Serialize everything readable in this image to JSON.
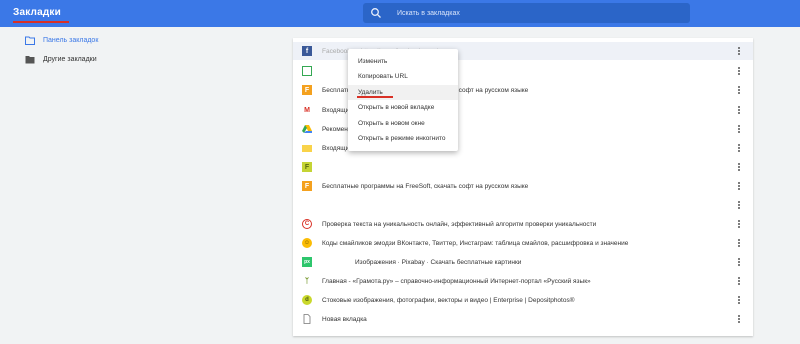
{
  "header": {
    "title": "Закладки",
    "search_placeholder": "Искать в закладках"
  },
  "sidebar": {
    "items": [
      {
        "label": "Панель закладок",
        "active": true
      },
      {
        "label": "Другие закладки",
        "active": false
      }
    ]
  },
  "bookmarks": [
    {
      "icon": "facebook-icon",
      "text": "Facebook — https://www.facebook.com/...",
      "faded": true
    },
    {
      "icon": "green-page-icon",
      "text": ""
    },
    {
      "icon": "freesoft-icon",
      "text": "Бесплатные программы на FreeSoft, скачать софт на русском языке"
    },
    {
      "icon": "gmail-icon",
      "text": "Входящие"
    },
    {
      "icon": "google-drive-icon",
      "text": "Рекомендации"
    },
    {
      "icon": "mail-icon",
      "text": "Входящие"
    },
    {
      "icon": "yellow-page-icon",
      "text": ""
    },
    {
      "icon": "freesoft-icon",
      "text": "Бесплатные программы на FreeSoft, скачать софт на русском языке"
    },
    {
      "icon": "blank-icon",
      "text": ""
    },
    {
      "icon": "copyright-icon",
      "text": "Проверка текста на уникальность онлайн, эффективный алгоритм проверки уникальности"
    },
    {
      "icon": "smiley-icon",
      "text": "Коды смайликов эмодзи ВКонтакте, Твиттер, Инстаграм: таблица смайлов, расшифровка и значение"
    },
    {
      "icon": "pixabay-icon",
      "text": "Изображения · Pixabay · Скачать бесплатные картинки"
    },
    {
      "icon": "gramota-icon",
      "text": "Главная - «Грамота.ру» – справочно-информационный Интернет-портал «Русский язык»"
    },
    {
      "icon": "depositphotos-icon",
      "text": "Стоковые изображения, фотографии, векторы и видео | Enterprise | Depositphotos®"
    },
    {
      "icon": "page-icon",
      "text": "Новая вкладка"
    }
  ],
  "context_menu": {
    "items": [
      {
        "label": "Изменить"
      },
      {
        "label": "Копировать URL"
      },
      {
        "label": "Удалить"
      },
      {
        "label": "Открыть в новой вкладке"
      },
      {
        "label": "Открыть в новом окне"
      },
      {
        "label": "Открыть в режиме инкогнито"
      }
    ]
  },
  "colors": {
    "accent": "#3b78e7",
    "underline": "#d93025"
  }
}
